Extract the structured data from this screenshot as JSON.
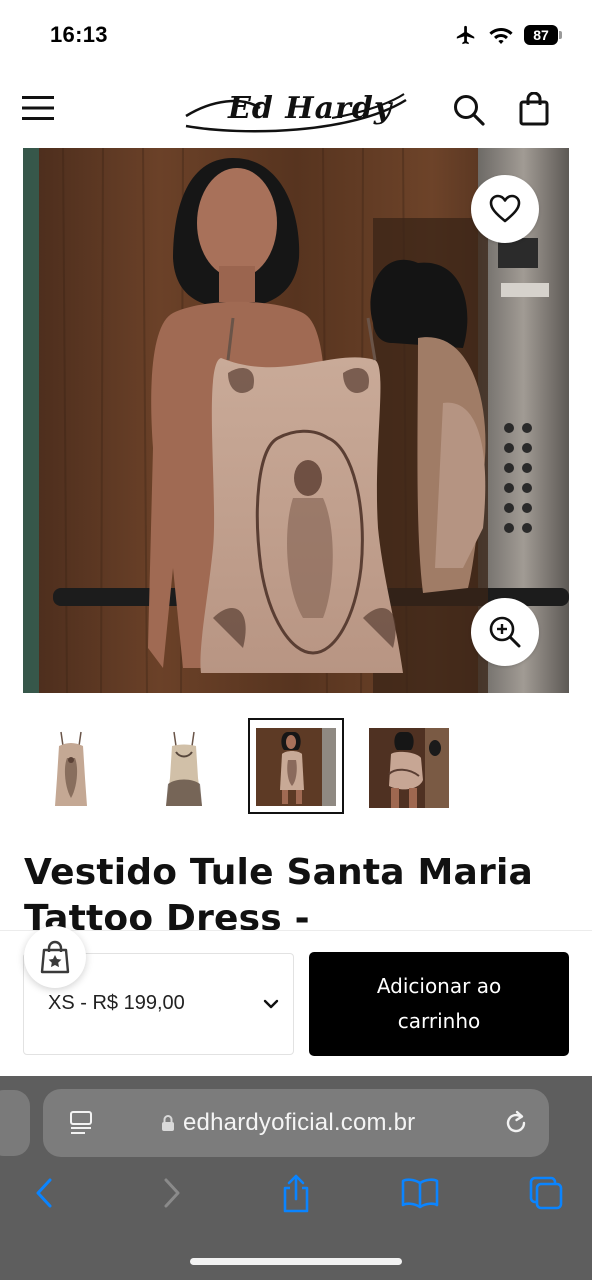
{
  "status_bar": {
    "time": "16:13",
    "battery": "87",
    "icons": [
      "airplane-icon",
      "wifi-icon",
      "battery-icon"
    ]
  },
  "header": {
    "logo_text": "Ed Hardy",
    "icons": [
      "menu-icon",
      "search-icon",
      "shopping-bag-icon"
    ]
  },
  "gallery": {
    "main_image_alt": "Model wearing the Vestido Tule Santa Maria Tattoo Dress in an elevator",
    "buttons": [
      "heart-icon",
      "zoom-in-icon"
    ],
    "thumbnails_count": 4,
    "active_thumbnail": 3
  },
  "product": {
    "title": "Vestido Tule Santa Maria Tattoo Dress -"
  },
  "purchase_bar": {
    "variant_selected": "XS - R$ 199,00",
    "add_to_cart_label": "Adicionar ao carrinho",
    "badge_icon": "shopping-bag-star-icon"
  },
  "browser": {
    "url": "edhardyoficial.com.br",
    "icons": [
      "reader-mode-icon",
      "lock-icon",
      "reload-icon",
      "back-icon",
      "forward-icon",
      "share-icon",
      "bookmarks-icon",
      "tabs-icon"
    ]
  },
  "colors": {
    "accent_black": "#000000",
    "browser_chrome": "#5e5e5e",
    "safari_blue": "#0a84ff"
  }
}
